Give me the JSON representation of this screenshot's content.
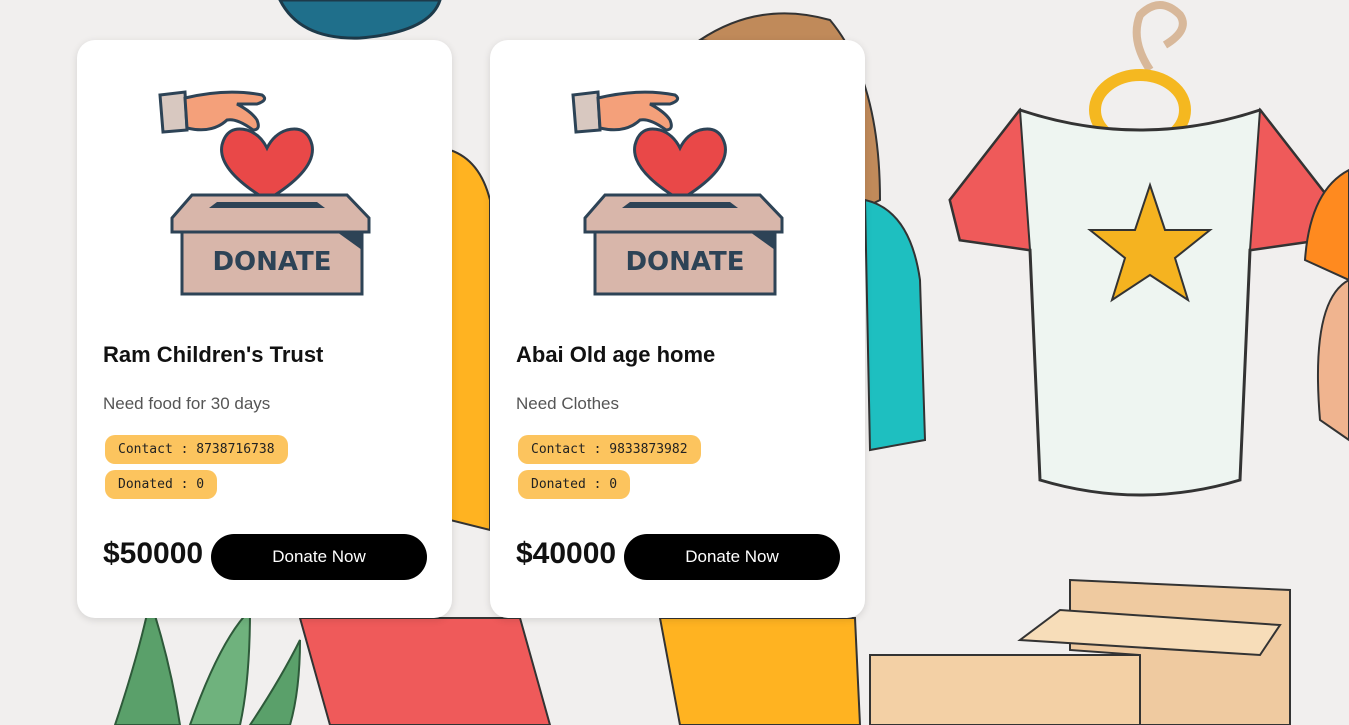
{
  "colors": {
    "card_bg": "#ffffff",
    "tag_bg": "#fcc45e",
    "button_bg": "#000000",
    "button_text": "#ffffff",
    "page_bg": "#f1efee"
  },
  "icons": [
    "donate-box-illustration",
    "heart-icon",
    "hand-icon"
  ],
  "cards": [
    {
      "illustration_label": "DONATE",
      "title": "Ram Children's Trust",
      "description": "Need food for 30 days",
      "contact": "Contact : 8738716738",
      "donated": "Donated : 0",
      "amount": "$50000",
      "button_label": "Donate Now"
    },
    {
      "illustration_label": "DONATE",
      "title": "Abai Old age home",
      "description": "Need Clothes",
      "contact": "Contact : 9833873982",
      "donated": "Donated : 0",
      "amount": "$40000",
      "button_label": "Donate Now"
    }
  ]
}
